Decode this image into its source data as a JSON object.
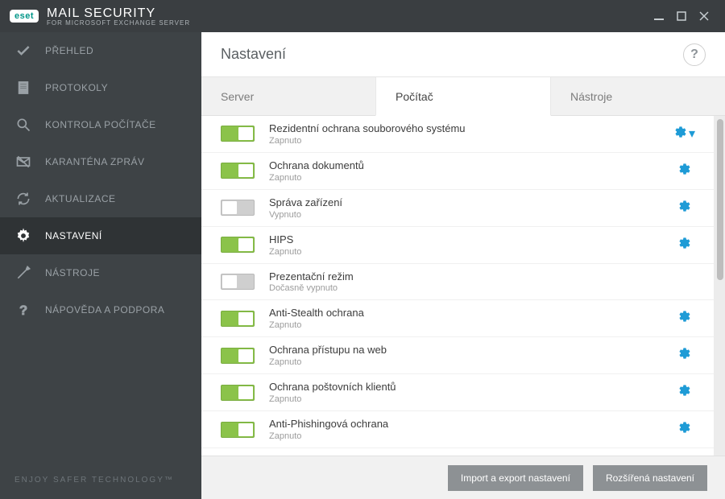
{
  "brand": {
    "badge": "eset",
    "title": "MAIL SECURITY",
    "subtitle": "FOR MICROSOFT EXCHANGE SERVER"
  },
  "tagline": "ENJOY SAFER TECHNOLOGY™",
  "sidebar": {
    "items": [
      {
        "label": "PŘEHLED"
      },
      {
        "label": "PROTOKOLY"
      },
      {
        "label": "KONTROLA POČÍTAČE"
      },
      {
        "label": "KARANTÉNA ZPRÁV"
      },
      {
        "label": "AKTUALIZACE"
      },
      {
        "label": "NASTAVENÍ"
      },
      {
        "label": "NÁSTROJE"
      },
      {
        "label": "NÁPOVĚDA A PODPORA"
      }
    ]
  },
  "main": {
    "title": "Nastavení",
    "tabs": [
      {
        "label": "Server"
      },
      {
        "label": "Počítač"
      },
      {
        "label": "Nástroje"
      }
    ],
    "rows": [
      {
        "title": "Rezidentní ochrana souborového systému",
        "sub": "Zapnuto",
        "on": true,
        "dropdown": true
      },
      {
        "title": "Ochrana dokumentů",
        "sub": "Zapnuto",
        "on": true,
        "dropdown": false
      },
      {
        "title": "Správa zařízení",
        "sub": "Vypnuto",
        "on": false,
        "dropdown": false
      },
      {
        "title": "HIPS",
        "sub": "Zapnuto",
        "on": true,
        "dropdown": false
      },
      {
        "title": "Prezentační režim",
        "sub": "Dočasně vypnuto",
        "on": false,
        "nogear": true
      },
      {
        "title": "Anti-Stealth ochrana",
        "sub": "Zapnuto",
        "on": true,
        "dropdown": false
      },
      {
        "title": "Ochrana přístupu na web",
        "sub": "Zapnuto",
        "on": true,
        "dropdown": false
      },
      {
        "title": "Ochrana poštovních klientů",
        "sub": "Zapnuto",
        "on": true,
        "dropdown": false
      },
      {
        "title": "Anti-Phishingová ochrana",
        "sub": "Zapnuto",
        "on": true,
        "dropdown": false
      }
    ]
  },
  "footer": {
    "import": "Import a export nastavení",
    "advanced": "Rozšířená nastavení"
  }
}
